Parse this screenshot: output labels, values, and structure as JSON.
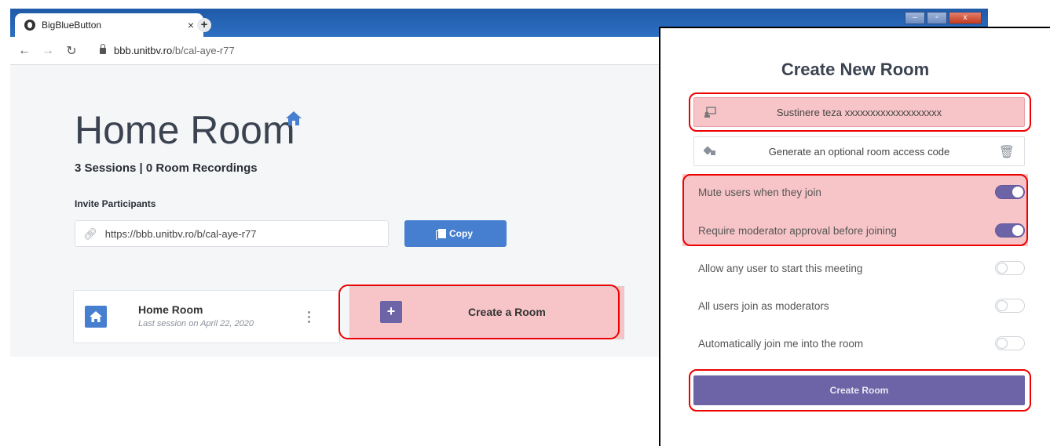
{
  "browser": {
    "tab_title": "BigBlueButton",
    "tab_close": "×",
    "new_tab": "+",
    "url_host": "bbb.unitbv.ro",
    "url_path": "/b/cal-aye-r77"
  },
  "page": {
    "room_title": "Home Room",
    "sessions_text": "3 Sessions | 0 Room Recordings",
    "invite_label": "Invite Participants",
    "invite_url": "https://bbb.unitbv.ro/b/cal-aye-r77",
    "copy_label": "Copy",
    "room_card": {
      "name": "Home Room",
      "last_session": "Last session on April 22, 2020"
    },
    "create_room_card_label": "Create a Room",
    "create_room_plus": "+"
  },
  "modal": {
    "title": "Create New Room",
    "room_name_value": "Sustinere teza xxxxxxxxxxxxxxxxxxx",
    "access_code_label": "Generate an optional room access code",
    "options": [
      {
        "label": "Mute users when they join",
        "enabled": true
      },
      {
        "label": "Require moderator approval before joining",
        "enabled": true
      },
      {
        "label": "Allow any user to start this meeting",
        "enabled": false
      },
      {
        "label": "All users join as moderators",
        "enabled": false
      },
      {
        "label": "Automatically join me into the room",
        "enabled": false
      }
    ],
    "submit_label": "Create Room"
  },
  "colors": {
    "accent_purple": "#6c64a6",
    "accent_blue": "#467fcf",
    "highlight_red": "#e00000",
    "highlight_fill": "#f7c5c8"
  }
}
